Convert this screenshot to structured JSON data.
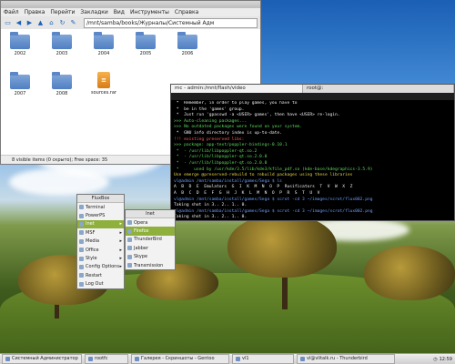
{
  "file_manager": {
    "menu": [
      "Файл",
      "Правка",
      "Перейти",
      "Закладки",
      "Вид",
      "Инструменты",
      "Справка"
    ],
    "address": "/mnt/samba/books/Журналы/Системный Адм",
    "items": [
      {
        "name": "2002",
        "icon": "folder-icon"
      },
      {
        "name": "2003",
        "icon": "folder-icon"
      },
      {
        "name": "2004",
        "icon": "folder-icon"
      },
      {
        "name": "2005",
        "icon": "folder-icon"
      },
      {
        "name": "2006",
        "icon": "folder-icon"
      },
      {
        "name": "2007",
        "icon": "folder-icon"
      },
      {
        "name": "2008",
        "icon": "folder-icon"
      },
      {
        "name": "sources.rar",
        "icon": "archive-icon"
      }
    ],
    "status": "8 visible items (0 скрыто); Free space: 35"
  },
  "terminal": {
    "tabs": [
      "mc - admin:/mnt/flash/video",
      "root@:"
    ],
    "lines": [
      {
        "text": "",
        "color": "white"
      },
      {
        "text": " *  Remember, in order to play games, you have to",
        "color": "white"
      },
      {
        "text": " *  be in the 'games' group.",
        "color": "white"
      },
      {
        "text": " *  Just run 'gpasswd -a <USER> games', then have <USER> re-login.",
        "color": "white"
      },
      {
        "text": ">>> Auto-cleaning packages...",
        "color": "green"
      },
      {
        "text": "",
        "color": "white"
      },
      {
        "text": ">>> No outdated packages were found on your system.",
        "color": "green"
      },
      {
        "text": "",
        "color": "white"
      },
      {
        "text": " *  GNU info directory index is up-to-date.",
        "color": "white"
      },
      {
        "text": "",
        "color": "white"
      },
      {
        "text": "!!! existing preserved libs:",
        "color": "red"
      },
      {
        "text": ">>> package: app-text/poppler-bindings-0.10.1",
        "color": "green"
      },
      {
        "text": " *  - /usr/lib/libpoppler-qt.so.2",
        "color": "green"
      },
      {
        "text": " *  - /usr/lib/libpoppler-qt.so.2.0.0",
        "color": "green"
      },
      {
        "text": " *  - /usr/lib/libpoppler-qt.so.2.0.0",
        "color": "green"
      },
      {
        "text": " *      used by /usr/kde/3.5/lib/kde3/kfile_pdf.so (kde-base/kdegraphics-3.5.9)",
        "color": "green"
      },
      {
        "text": "Use emerge @preserved-rebuild to rebuild packages using these libraries",
        "color": "yellow"
      },
      {
        "text": "vl@admin /mnt/samba/install/games/Sega $ ls",
        "color": "blue"
      },
      {
        "text": "A  B  D  E  Emulators  G  I  K  M  N  O  P  Rusificators  T  V  W  X  Z",
        "color": "white"
      },
      {
        "text": "A  B  C  D  E  F  G  H  J  K  L  M  N  O  P  R  S  T  U  V",
        "color": "white"
      },
      {
        "text": "vl@admin /mnt/samba/install/games/Sega $ scrot -cd 3 ~/images/scrot/flux002.png",
        "color": "blue"
      },
      {
        "text": "Taking shot in 3.. 2.. 1.. 0.",
        "color": "white"
      },
      {
        "text": "vl@admin /mnt/samba/install/games/Sega $ scrot -cd 3 ~/images/scrot/flux002.png",
        "color": "blue"
      },
      {
        "text": "Taking shot in 3.. 2.. 1.. 0.",
        "color": "white"
      },
      {
        "text": "vl@admin /mnt/samba/install/games/Sega $ scrot -cd 3 ~/images/scrot/flux002.png",
        "color": "blue"
      },
      {
        "text": "Taking shot in 3.. 2.. 1.. 0.",
        "color": "white"
      }
    ]
  },
  "menu": {
    "title": "FluxBox",
    "items": [
      "Terminal",
      "PowerPS",
      "Inet",
      "MSF",
      "Media",
      "Office",
      "Style",
      "Config Options",
      "Restart",
      "Log Out"
    ],
    "selected_index": 2,
    "submenu_title": "Inet",
    "submenu_items": [
      "Opera",
      "Firefox",
      "ThunderBird",
      "Jabber",
      "Skype",
      "Transmission"
    ],
    "submenu_selected_index": 1
  },
  "taskbar": {
    "tasks": [
      "Системный Администратор",
      "rootfc",
      "Галерея - Скриншоты - Gentoo",
      "vl1",
      "vl@vlitalk.ru - Thunderbird"
    ],
    "clock": "12:59"
  },
  "colors": {
    "menu_highlight": "#8fb03c",
    "terminal_bg": "#000000",
    "folder": "#5b87c8"
  }
}
